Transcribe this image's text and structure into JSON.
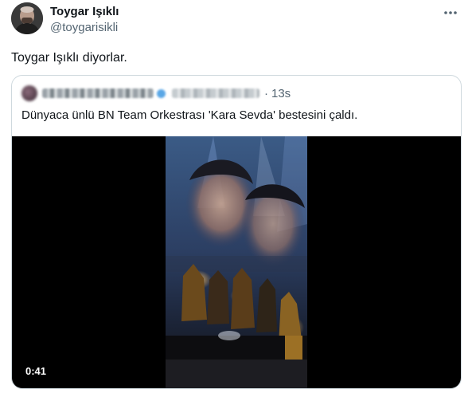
{
  "author": {
    "name": "Toygar Işıklı",
    "handle": "@toygarisikli",
    "avatar_icon": "user-avatar"
  },
  "more_icon": "more-horizontal-icon",
  "tweet": {
    "text": "Toygar Işıklı diyorlar."
  },
  "quote": {
    "time": "13s",
    "separator": "·",
    "text": "Dünyaca ünlü BN Team Orkestrası 'Kara Sevda' bestesini çaldı.",
    "video": {
      "duration": "0:41"
    }
  },
  "colors": {
    "text_primary": "#0f1419",
    "text_secondary": "#536471",
    "border": "#cfd9de",
    "video_bg": "#000000"
  }
}
